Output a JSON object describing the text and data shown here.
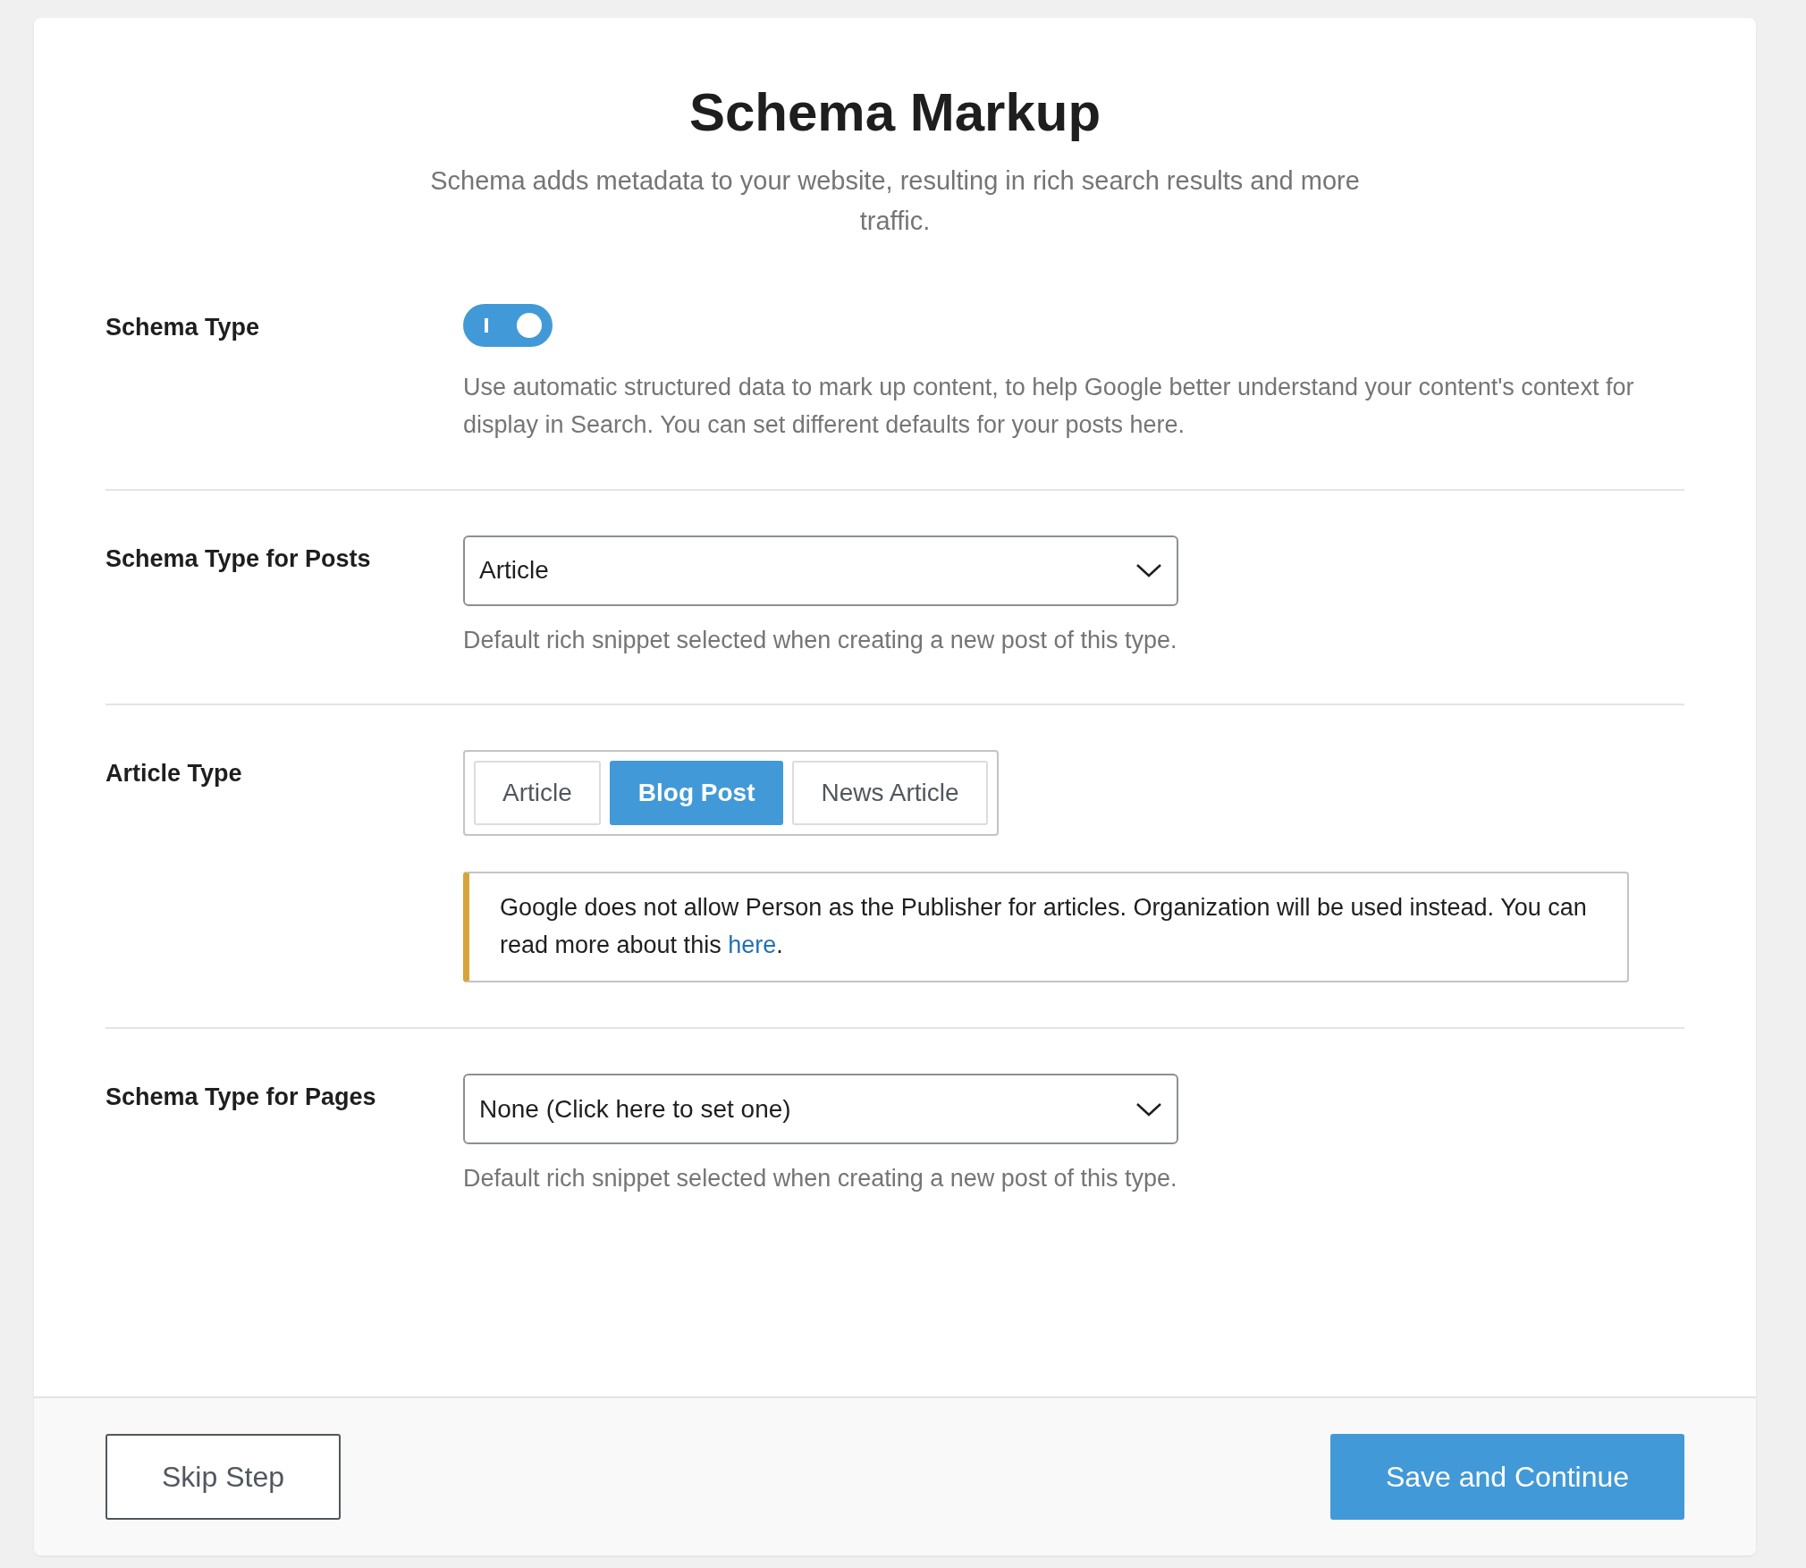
{
  "header": {
    "title": "Schema Markup",
    "subtitle": "Schema adds metadata to your website, resulting in rich search results and more traffic."
  },
  "settings": [
    {
      "kind": "toggle",
      "label": "Schema Type",
      "on": true,
      "help": "Use automatic structured data to mark up content, to help Google better understand your content's context for display in Search. You can set different defaults for your posts here."
    },
    {
      "kind": "select",
      "label": "Schema Type for Posts",
      "value": "Article",
      "help": "Default rich snippet selected when creating a new post of this type."
    },
    {
      "kind": "segmented",
      "label": "Article Type",
      "options": [
        {
          "label": "Article",
          "selected": false
        },
        {
          "label": "Blog Post",
          "selected": true
        },
        {
          "label": "News Article",
          "selected": false
        }
      ],
      "notice": {
        "text": "Google does not allow Person as the Publisher for articles. Organization will be used instead. You can read more about this ",
        "link": "here",
        "after": "."
      }
    },
    {
      "kind": "select",
      "label": "Schema Type for Pages",
      "value": "None (Click here to set one)",
      "help": "Default rich snippet selected when creating a new post of this type."
    }
  ],
  "footer": {
    "skip": "Skip Step",
    "save": "Save and Continue"
  }
}
